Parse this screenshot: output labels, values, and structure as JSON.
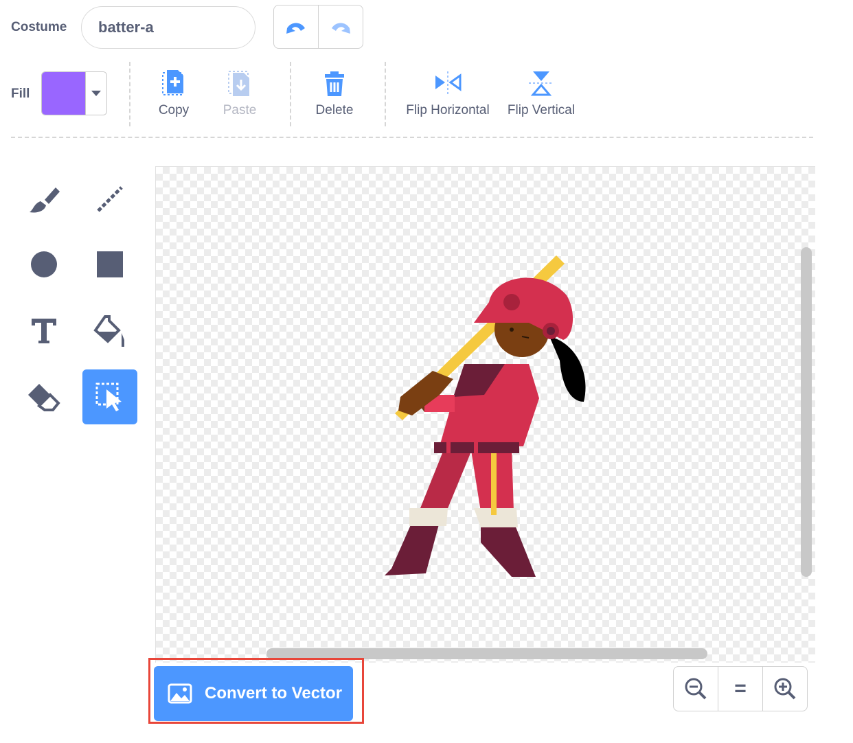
{
  "header": {
    "costume_label": "Costume",
    "costume_name": "batter-a"
  },
  "toolbar": {
    "fill_label": "Fill",
    "fill_color": "#9966ff",
    "copy_label": "Copy",
    "paste_label": "Paste",
    "delete_label": "Delete",
    "flip_horizontal_label": "Flip Horizontal",
    "flip_vertical_label": "Flip Vertical"
  },
  "tools": [
    "brush-icon",
    "line-icon",
    "circle-icon",
    "rectangle-icon",
    "text-icon",
    "fill-bucket-icon",
    "eraser-icon",
    "select-icon"
  ],
  "active_tool": "select",
  "canvas": {
    "sprite": "batter"
  },
  "bottom": {
    "convert_label": "Convert to Vector",
    "zoom_reset_label": "="
  },
  "colors": {
    "accent": "#4c97ff",
    "text": "#575e75",
    "highlight": "#e8463a",
    "tool_icon": "#575e75"
  }
}
